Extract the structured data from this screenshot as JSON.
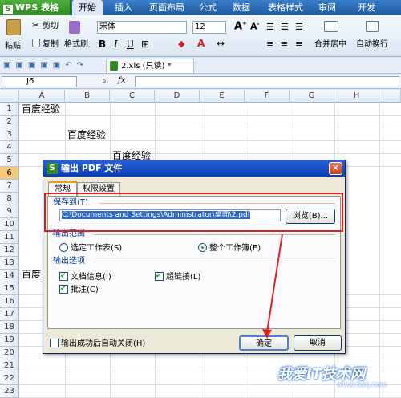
{
  "app": {
    "name": "WPS 表格"
  },
  "menu": [
    "开始",
    "插入",
    "页面布局",
    "公式",
    "数据",
    "表格样式",
    "审阅",
    "开发"
  ],
  "ribbon": {
    "paste": "粘贴",
    "cut": "剪切",
    "copy": "复制",
    "format_painter": "格式刷",
    "font_name": "宋体",
    "font_size": "12",
    "merge_center": "合并居中",
    "auto_wrap": "自动换行"
  },
  "document_tab": "2.xls (只读) *",
  "name_box": "J6",
  "fx_label": "fx",
  "columns": [
    "A",
    "B",
    "C",
    "D",
    "E",
    "F",
    "G",
    "H"
  ],
  "rows": [
    "1",
    "2",
    "3",
    "4",
    "5",
    "6",
    "7",
    "8",
    "9",
    "10",
    "11",
    "12",
    "13",
    "14",
    "15",
    "16",
    "17",
    "18",
    "19",
    "20",
    "21",
    "22",
    "23"
  ],
  "selected_row": "6",
  "cells": {
    "a1": "百度经验",
    "b3": "百度经验",
    "c5": "百度经验",
    "a15": "百度"
  },
  "dialog": {
    "title": "输出 PDF 文件",
    "tabs": [
      "常规",
      "权限设置"
    ],
    "save_to_label": "保存到(T)",
    "save_path": "C:\\Documents and Settings\\Administrator\\桌面\\2.pdf",
    "browse": "浏览(B)...",
    "range_label": "输出范围",
    "range_options": [
      "选定工作表(S)",
      "整个工作簿(E)"
    ],
    "options_label": "输出选项",
    "options": [
      "文档信息(I)",
      "超链接(L)",
      "批注(C)"
    ],
    "close_after": "输出成功后自动关闭(H)",
    "ok": "确定",
    "cancel": "取消"
  },
  "watermark": {
    "text": "我爱IT技术网",
    "url": "www.52ij.com"
  },
  "colors": {
    "highlight": "#e02020",
    "menubar": "#1e5a9e",
    "brand": "#2f8a22"
  }
}
